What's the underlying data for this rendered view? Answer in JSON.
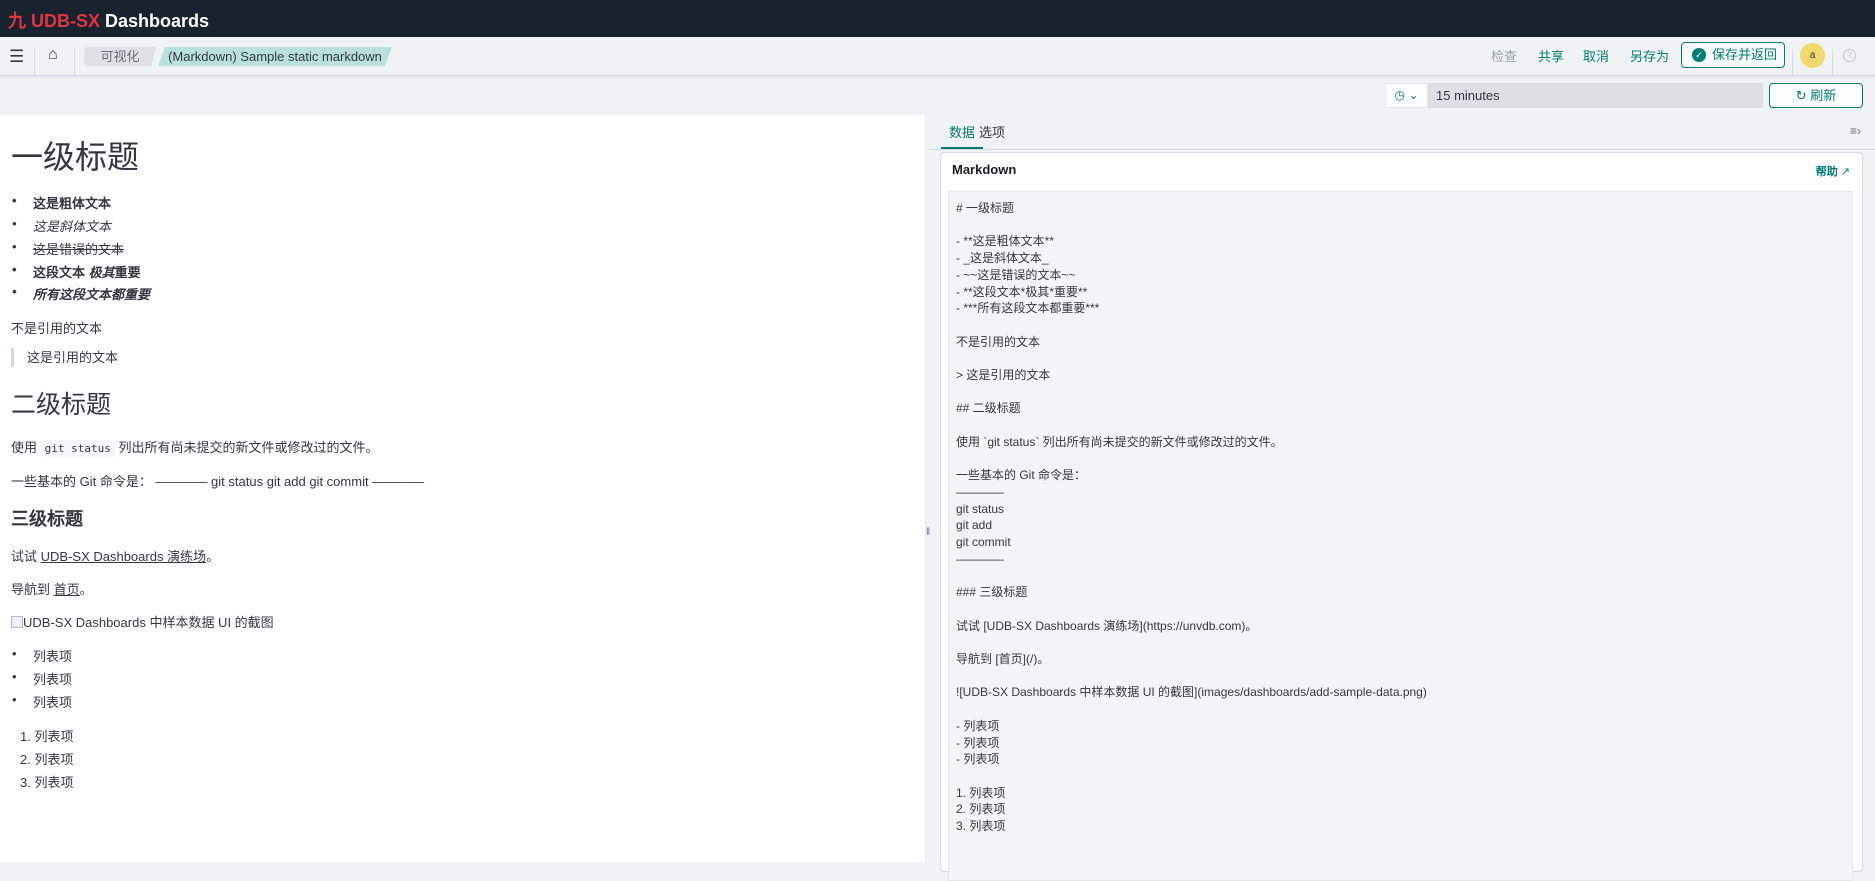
{
  "app": {
    "logo_glyph": "九",
    "logo_brand": "UDB-SX",
    "logo_rest": " Dashboards"
  },
  "breadcrumbs": [
    "可视化",
    "(Markdown) Sample static markdown"
  ],
  "nav_actions": {
    "inspect": "检查",
    "share": "共享",
    "cancel": "取消",
    "save_as": "另存为",
    "save_return": "保存并返回"
  },
  "user": {
    "avatar": "a"
  },
  "time": {
    "value": "15 minutes",
    "refresh": "刷新"
  },
  "preview": {
    "h1": "一级标题",
    "bullets": [
      "这是粗体文本",
      "这是斜体文本",
      "这是错误的文本",
      "这段文本 ",
      "极其",
      "重要",
      "所有这段文本都重要"
    ],
    "para1": "不是引用的文本",
    "quote": "这是引用的文本",
    "h2": "二级标题",
    "use_pre": "使用 ",
    "use_code": "git status",
    "use_post": " 列出所有尚未提交的新文件或修改过的文件。",
    "git_line": "一些基本的 Git 命令是： ———— git status git add git commit ————",
    "h3": "三级标题",
    "try_pre": "试试 ",
    "try_link": "UDB-SX Dashboards 演练场",
    "try_post": "。",
    "nav_pre": "导航到 ",
    "nav_link": "首页",
    "nav_post": "。",
    "img_alt": "UDB-SX Dashboards 中样本数据 UI 的截图",
    "list": [
      "列表项",
      "列表项",
      "列表项"
    ],
    "olist": [
      "1. 列表项",
      "2. 列表项",
      "3. 列表项"
    ]
  },
  "editor_panel": {
    "tabs": [
      "数据",
      "选项"
    ],
    "card_title": "Markdown",
    "help": "帮助",
    "markdown": "# 一级标题\n\n- **这是粗体文本**\n- _这是斜体文本_\n- ~~这是错误的文本~~\n- **这段文本*极其*重要**\n- ***所有这段文本都重要***\n\n不是引用的文本\n\n> 这是引用的文本\n\n## 二级标题\n\n使用 `git status` 列出所有尚未提交的新文件或修改过的文件。\n\n一些基本的 Git 命令是：\n————\ngit status\ngit add\ngit commit\n————\n\n### 三级标题\n\n试试 [UDB-SX Dashboards 演练场](https://unvdb.com)。\n\n导航到 [首页](/)。\n\n![UDB-SX Dashboards 中样本数据 UI 的截图](images/dashboards/add-sample-data.png)\n\n- 列表项\n- 列表项\n- 列表项\n\n1. 列表项\n2. 列表项\n3. 列表项\n"
  },
  "colors": {
    "accent": "#017d73",
    "header": "#19222f",
    "brand_red": "#e0353f"
  }
}
